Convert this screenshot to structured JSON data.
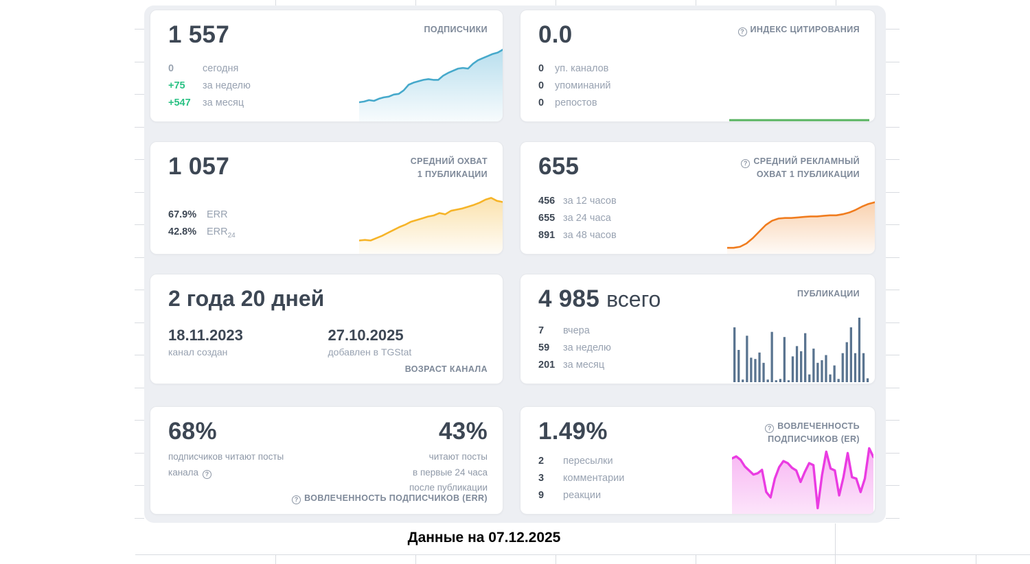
{
  "colors": {
    "panel_bg": "#edeff3",
    "card_bg": "#ffffff",
    "dark_text": "#3d4754",
    "label_gray": "#7e8999",
    "stat_label_gray": "#98a2b1",
    "green_delta": "#2bc184",
    "blue_line": "#46a9cb",
    "green_line": "#57b35f",
    "amber_line": "#f6b428",
    "orange_line": "#f07c1e",
    "bar_slate": "#5a7490",
    "pink_line": "#ea3ce2"
  },
  "icons": {
    "help": "?"
  },
  "cards": [
    {
      "name": "subscribers",
      "big": "1 557",
      "label": "ПОДПИСЧИКИ",
      "stats": [
        {
          "value": "0",
          "label": "сегодня"
        },
        {
          "value": "+75",
          "label": "за неделю"
        },
        {
          "value": "+547",
          "label": "за месяц"
        }
      ]
    },
    {
      "name": "citation-index",
      "big": "0.0",
      "label": "ИНДЕКС ЦИТИРОВАНИЯ",
      "stats": [
        {
          "value": "0",
          "label": "уп. каналов"
        },
        {
          "value": "0",
          "label": "упоминаний"
        },
        {
          "value": "0",
          "label": "репостов"
        }
      ]
    },
    {
      "name": "avg-post-reach",
      "big": "1 057",
      "label_lines": [
        "СРЕДНИЙ ОХВАТ",
        "1 ПУБЛИКАЦИИ"
      ],
      "stats": [
        {
          "value": "67.9%",
          "label": "ERR"
        },
        {
          "value": "42.8%",
          "label": "ERR",
          "label_sub": "24"
        }
      ]
    },
    {
      "name": "avg-ad-reach",
      "big": "655",
      "label_lines": [
        "СРЕДНИЙ РЕКЛАМНЫЙ",
        "ОХВАТ 1 ПУБЛИКАЦИИ"
      ],
      "stats": [
        {
          "value": "456",
          "label": "за 12 часов"
        },
        {
          "value": "655",
          "label": "за 24 часа"
        },
        {
          "value": "891",
          "label": "за 48 часов"
        }
      ]
    },
    {
      "name": "channel-age",
      "big": "2 года 20 дней",
      "date_created": {
        "value": "18.11.2023",
        "label": "канал создан"
      },
      "date_added": {
        "value": "27.10.2025",
        "label": "добавлен в TGStat"
      },
      "corner_label": "ВОЗРАСТ КАНАЛА"
    },
    {
      "name": "publications",
      "big": "4 985",
      "big_suffix": "всего",
      "label": "ПУБЛИКАЦИИ",
      "stats": [
        {
          "value": "7",
          "label": "вчера"
        },
        {
          "value": "59",
          "label": "за неделю"
        },
        {
          "value": "201",
          "label": "за месяц"
        }
      ]
    },
    {
      "name": "err",
      "left_big": "68%",
      "left_desc_lines": [
        "подписчиков читают посты",
        "канала"
      ],
      "right_big": "43%",
      "right_desc_lines": [
        "читают посты",
        "в первые 24 часа",
        "после публикации"
      ],
      "corner_label": "ВОВЛЕЧЕННОСТЬ ПОДПИСЧИКОВ (ERR)"
    },
    {
      "name": "er",
      "big": "1.49%",
      "label_lines": [
        "ВОВЛЕЧЕННОСТЬ",
        "ПОДПИСЧИКОВ (ER)"
      ],
      "stats": [
        {
          "value": "2",
          "label": "пересылки"
        },
        {
          "value": "3",
          "label": "комментарии"
        },
        {
          "value": "9",
          "label": "реакции"
        }
      ]
    }
  ],
  "footer": {
    "text": "Данные на 07.12.2025"
  },
  "chart_data": [
    {
      "type": "area",
      "title": "ПОДПИСЧИКИ",
      "color": "#46a9cb",
      "fill": "#7fc4e0",
      "fill_opacity_top": 0.55,
      "fill_opacity_bottom": 0.06,
      "stroke_width": 2.6,
      "values": [
        0.25,
        0.26,
        0.28,
        0.27,
        0.3,
        0.32,
        0.33,
        0.36,
        0.37,
        0.42,
        0.5,
        0.53,
        0.55,
        0.57,
        0.58,
        0.57,
        0.57,
        0.63,
        0.67,
        0.7,
        0.73,
        0.74,
        0.73,
        0.8,
        0.85,
        0.88,
        0.91,
        0.94,
        0.96,
        1.0
      ]
    },
    {
      "type": "line",
      "title": "ИНДЕКС ЦИТИРОВАНИЯ",
      "color": "#57b35f",
      "stroke_width": 3,
      "values": [
        0.05,
        0.05,
        0.05,
        0.05,
        0.05,
        0.05,
        0.05,
        0.05
      ]
    },
    {
      "type": "area",
      "title": "СРЕДНИЙ ОХВАТ 1 ПУБЛИКАЦИИ",
      "color": "#f6b428",
      "fill": "#f6c55c",
      "fill_opacity_top": 0.5,
      "fill_opacity_bottom": 0.05,
      "stroke_width": 2.6,
      "values": [
        0.2,
        0.21,
        0.2,
        0.24,
        0.28,
        0.33,
        0.38,
        0.43,
        0.47,
        0.52,
        0.55,
        0.58,
        0.61,
        0.63,
        0.67,
        0.65,
        0.71,
        0.73,
        0.75,
        0.78,
        0.81,
        0.85,
        0.9,
        0.93,
        0.88,
        0.86
      ]
    },
    {
      "type": "area",
      "title": "СРЕДНИЙ РЕКЛАМНЫЙ ОХВАТ 1 ПУБЛИКАЦИИ",
      "color": "#f07c1e",
      "fill": "#f29a4e",
      "fill_opacity_top": 0.45,
      "fill_opacity_bottom": 0.05,
      "stroke_width": 2.6,
      "values": [
        0.08,
        0.08,
        0.1,
        0.16,
        0.26,
        0.38,
        0.5,
        0.58,
        0.62,
        0.63,
        0.63,
        0.64,
        0.65,
        0.66,
        0.66,
        0.67,
        0.68,
        0.68,
        0.7,
        0.73,
        0.78,
        0.84,
        0.89,
        0.92
      ]
    },
    {
      "type": "bar",
      "title": "ПУБЛИКАЦИИ",
      "color": "#5a7490",
      "values": [
        0.85,
        0.5,
        0.04,
        0.72,
        0.38,
        0.36,
        0.46,
        0.3,
        0.04,
        0.78,
        0.03,
        0.05,
        0.7,
        0.03,
        0.4,
        0.56,
        0.48,
        0.76,
        0.12,
        0.52,
        0.3,
        0.34,
        0.42,
        0.12,
        0.26,
        0.05,
        0.45,
        0.62,
        0.85,
        0.45,
        1.0,
        0.45,
        0.06
      ]
    },
    {
      "type": "area",
      "title": "ВОВЛЕЧЕННОСТЬ ПОДПИСЧИКОВ (ER)",
      "color": "#ea3ce2",
      "fill": "#ef6ae6",
      "fill_opacity_top": 0.5,
      "fill_opacity_bottom": 0.18,
      "stroke_width": 3.4,
      "values": [
        0.8,
        0.83,
        0.78,
        0.68,
        0.62,
        0.56,
        0.58,
        0.63,
        0.3,
        0.22,
        0.5,
        0.67,
        0.76,
        0.73,
        0.66,
        0.62,
        0.45,
        0.6,
        0.73,
        0.7,
        0.06,
        0.55,
        0.9,
        0.65,
        0.62,
        0.25,
        0.52,
        0.88,
        0.52,
        0.5,
        0.3,
        0.5,
        0.95,
        0.82
      ]
    }
  ]
}
